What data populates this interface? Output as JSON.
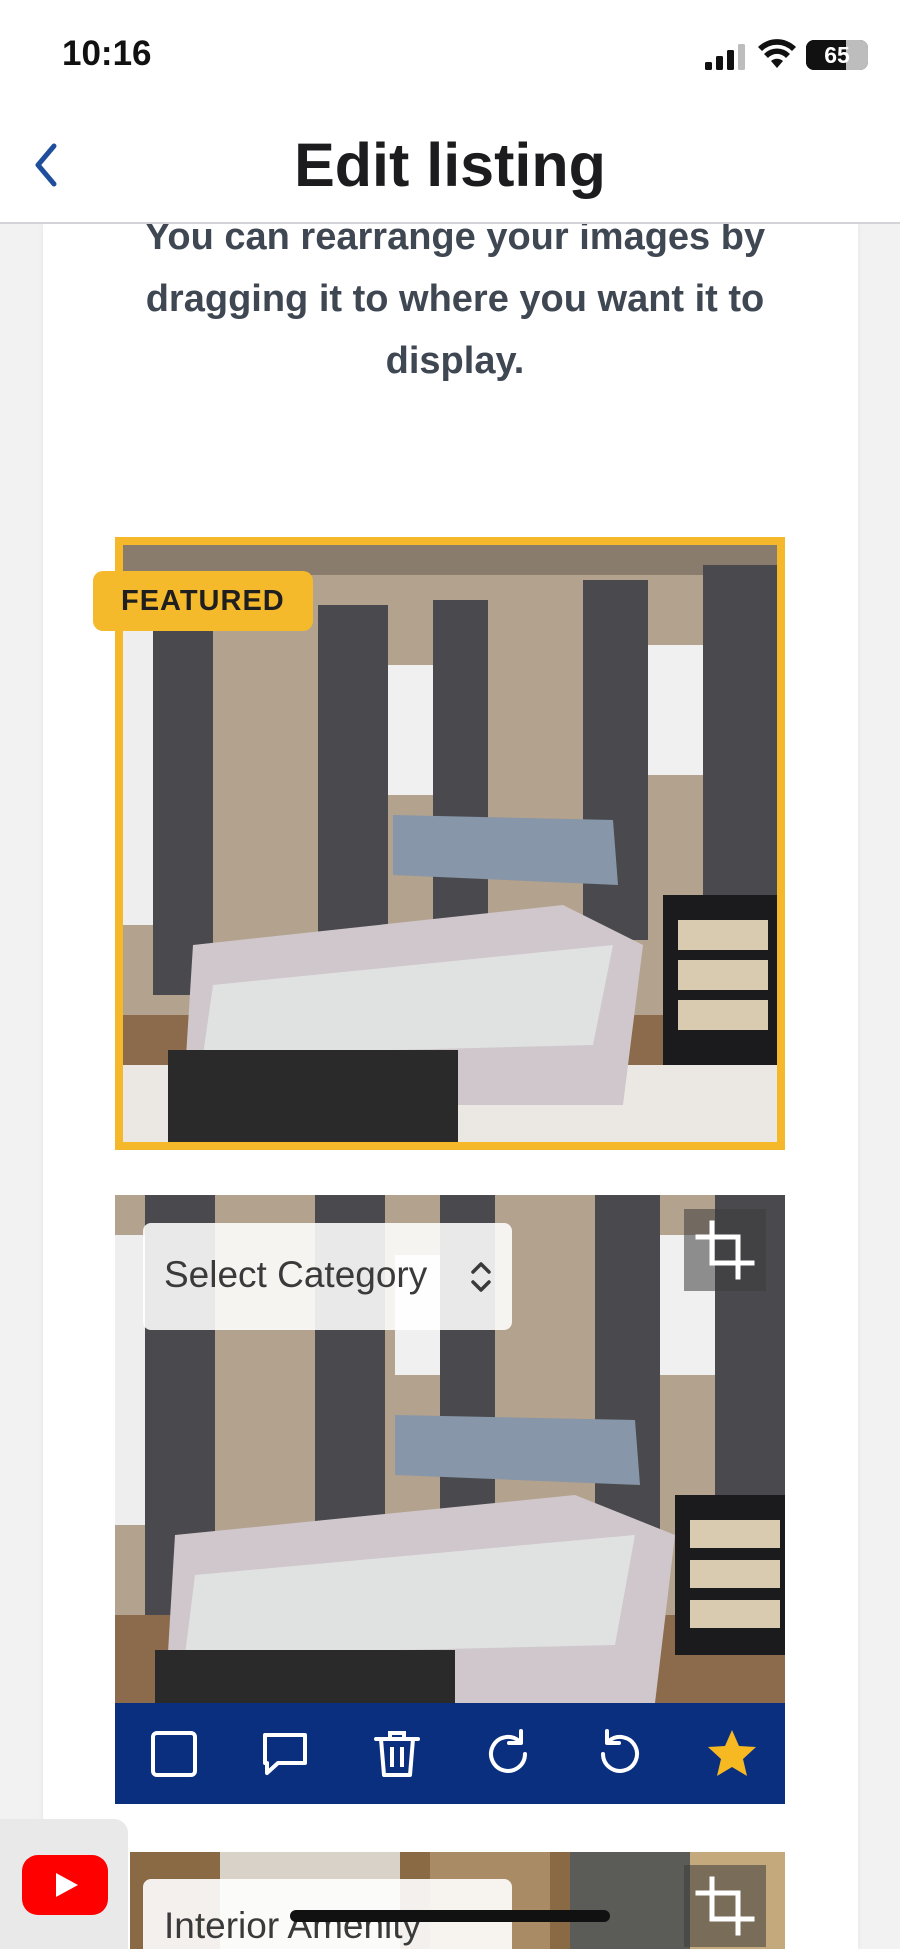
{
  "status_bar": {
    "time": "10:16",
    "battery": "65",
    "battery_level_fraction": 0.65
  },
  "header": {
    "title": "Edit listing",
    "back_icon": "chevron-left-icon"
  },
  "instructions": "You can rearrange your images by dragging it to where you want it to display.",
  "photos": [
    {
      "badge": "FEATURED",
      "category": ""
    },
    {
      "category": "Select Category",
      "actions": [
        "checkbox-icon",
        "comment-icon",
        "trash-icon",
        "rotate-clockwise-icon",
        "rotate-counterclockwise-icon",
        "star-icon"
      ]
    },
    {
      "category": "Interior Amenity"
    }
  ],
  "colors": {
    "accent": "#0a2f7e",
    "featured": "#f5b92c",
    "back_icon": "#1f4f9c",
    "star": "#f6b921"
  },
  "pip": {
    "app_icon": "youtube-icon"
  }
}
